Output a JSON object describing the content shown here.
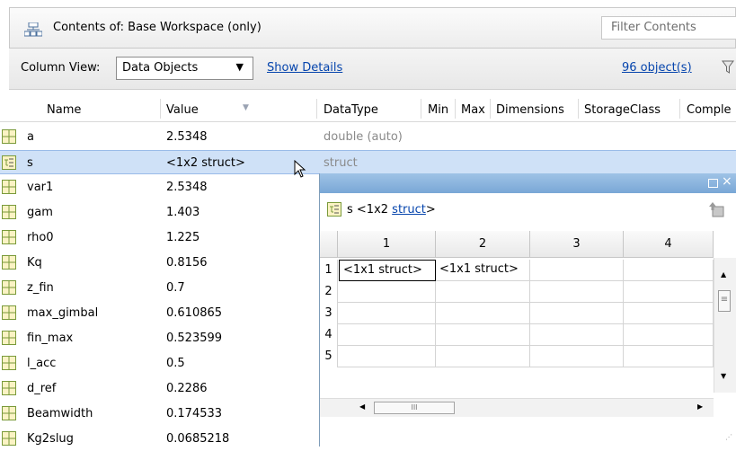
{
  "header": {
    "title": "Contents of:  Base Workspace (only)",
    "filter_placeholder": "Filter Contents"
  },
  "toolbar": {
    "column_view_label": "Column View:",
    "column_view_value": "Data Objects",
    "show_details": "Show Details",
    "object_count": "96 object(s)"
  },
  "columns": [
    "Name",
    "Value",
    "DataType",
    "Min",
    "Max",
    "Dimensions",
    "StorageClass",
    "Comple"
  ],
  "rows": [
    {
      "name": "a",
      "value": "2.5348",
      "datatype": "double (auto)"
    },
    {
      "name": "s",
      "value": "<1x2 struct>",
      "datatype": "struct"
    },
    {
      "name": "var1",
      "value": "2.5348",
      "datatype": ""
    },
    {
      "name": "gam",
      "value": "1.403",
      "datatype": ""
    },
    {
      "name": "rho0",
      "value": "1.225",
      "datatype": ""
    },
    {
      "name": "Kq",
      "value": "0.8156",
      "datatype": ""
    },
    {
      "name": "z_fin",
      "value": "0.7",
      "datatype": ""
    },
    {
      "name": "max_gimbal",
      "value": "0.610865",
      "datatype": ""
    },
    {
      "name": "fin_max",
      "value": "0.523599",
      "datatype": ""
    },
    {
      "name": "l_acc",
      "value": "0.5",
      "datatype": ""
    },
    {
      "name": "d_ref",
      "value": "0.2286",
      "datatype": ""
    },
    {
      "name": "Beamwidth",
      "value": "0.174533",
      "datatype": ""
    },
    {
      "name": "Kg2slug",
      "value": "0.0685218",
      "datatype": ""
    }
  ],
  "variable_editor": {
    "var_prefix": "s <1x2 ",
    "var_type_link": "struct",
    "var_suffix": ">",
    "close_glyph": "×",
    "col_headers": [
      "1",
      "2",
      "3",
      "4"
    ],
    "row_headers": [
      "1",
      "2",
      "3",
      "4",
      "5"
    ],
    "cells": [
      [
        "<1x1 struct>",
        "<1x1 struct>",
        "",
        ""
      ],
      [
        "",
        "",
        "",
        ""
      ],
      [
        "",
        "",
        "",
        ""
      ],
      [
        "",
        "",
        "",
        ""
      ],
      [
        "",
        "",
        "",
        ""
      ]
    ],
    "scroll_thumb_glyph": "III"
  },
  "colors": {
    "selection": "#cfe1f7",
    "link": "#0645ad",
    "title_bar": "#8bb5e0"
  }
}
